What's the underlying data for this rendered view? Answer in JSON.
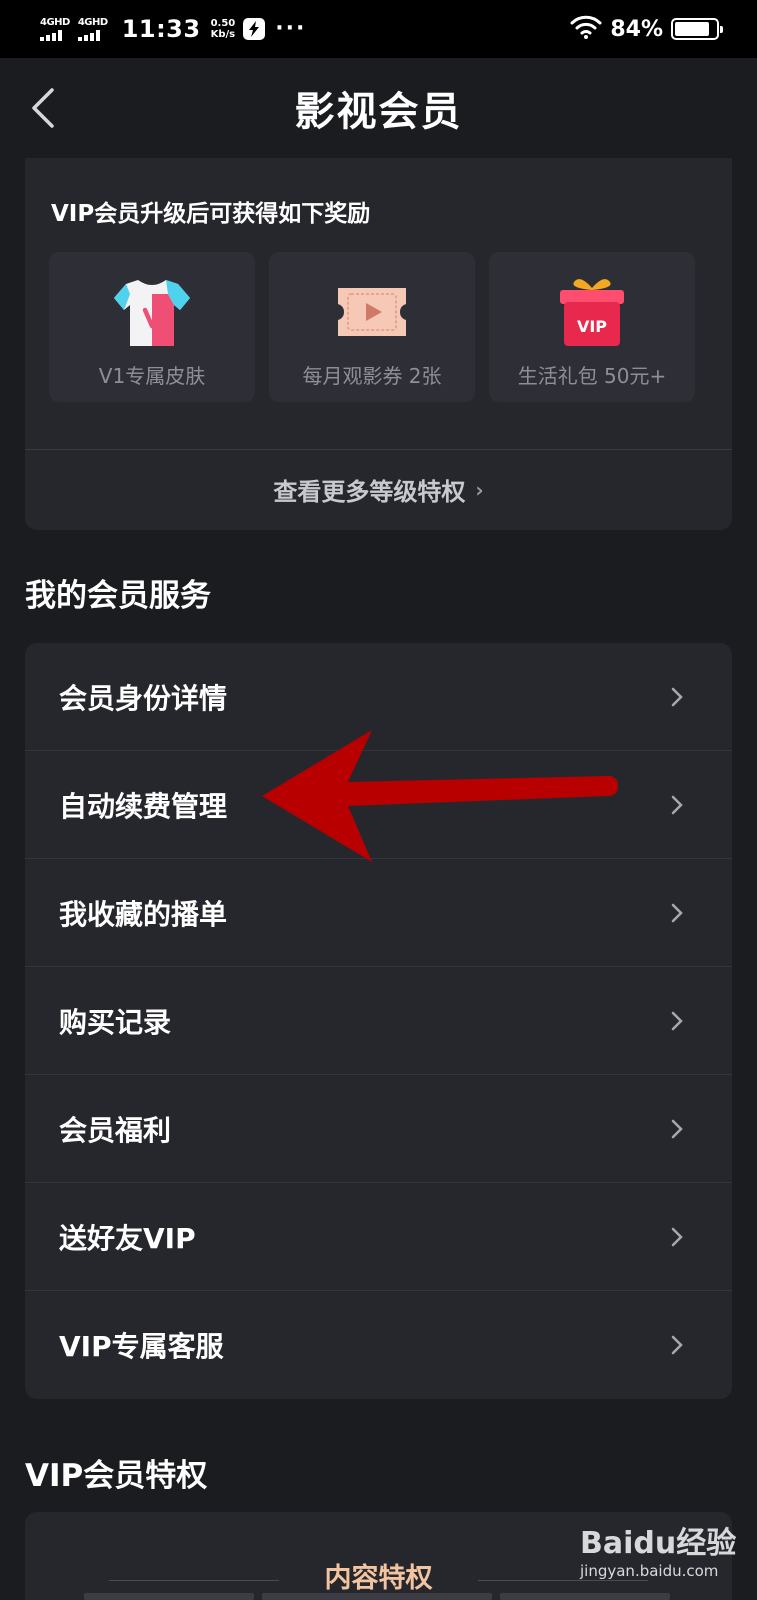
{
  "status_bar": {
    "signal_1_label": "4GHD",
    "signal_2_label": "4GHD",
    "time": "11:33",
    "speed_value": "0.50",
    "speed_unit": "Kb/s",
    "more": "···",
    "battery_percent": "84%",
    "battery_level": 0.84,
    "icons": [
      "signal-icon",
      "signal-icon",
      "flash-icon",
      "wifi-icon",
      "battery-icon"
    ]
  },
  "header": {
    "title": "影视会员",
    "back_icon": "chevron-left-icon"
  },
  "rewards": {
    "title": "VIP会员升级后可获得如下奖励",
    "items": [
      {
        "label": "V1专属皮肤",
        "icon": "tshirt-icon"
      },
      {
        "label": "每月观影券 2张",
        "icon": "ticket-icon"
      },
      {
        "label": "生活礼包 50元+",
        "icon": "gift-box-icon"
      }
    ],
    "gift_badge": "VIP",
    "more_link": "查看更多等级特权"
  },
  "services": {
    "title": "我的会员服务",
    "items": [
      {
        "label": "会员身份详情"
      },
      {
        "label": "自动续费管理"
      },
      {
        "label": "我收藏的播单"
      },
      {
        "label": "购买记录"
      },
      {
        "label": "会员福利"
      },
      {
        "label": "送好友VIP"
      },
      {
        "label": "VIP专属客服"
      }
    ]
  },
  "privileges": {
    "title": "VIP会员特权",
    "subtitle": "内容特权"
  },
  "watermark": {
    "brand": "Baidu经验",
    "url": "jingyan.baidu.com"
  },
  "colors": {
    "background": "#1b1c20",
    "card": "#26272d",
    "tile": "#2e2f36",
    "accent_peach": "#f2c4a0",
    "annotation_red": "#b80000"
  }
}
